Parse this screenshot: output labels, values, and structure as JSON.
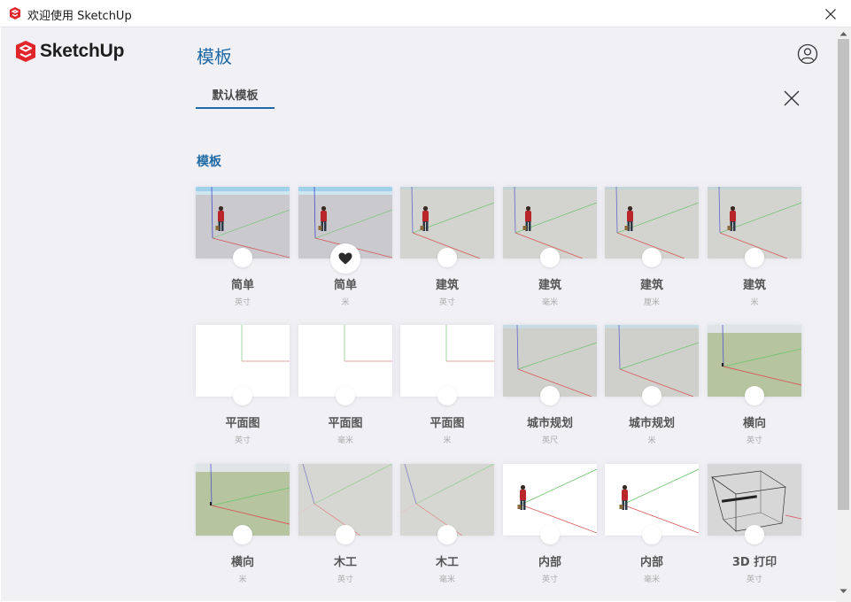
{
  "window": {
    "title": "欢迎使用 SketchUp"
  },
  "brand": {
    "logo_text": "SketchUp",
    "accent_color": "#1f6aa6",
    "logo_color": "#e0262b"
  },
  "header": {
    "page_title": "模板"
  },
  "tabs": [
    {
      "label": "默认模板",
      "active": true
    }
  ],
  "section": {
    "title": "模板"
  },
  "templates": [
    {
      "name": "简单",
      "unit": "英寸",
      "style": "simple",
      "favorite": false
    },
    {
      "name": "简单",
      "unit": "米",
      "style": "simple",
      "favorite": true
    },
    {
      "name": "建筑",
      "unit": "英寸",
      "style": "arch",
      "favorite": false
    },
    {
      "name": "建筑",
      "unit": "毫米",
      "style": "arch",
      "favorite": false
    },
    {
      "name": "建筑",
      "unit": "厘米",
      "style": "arch",
      "favorite": false
    },
    {
      "name": "建筑",
      "unit": "米",
      "style": "arch",
      "favorite": false
    },
    {
      "name": "平面图",
      "unit": "英寸",
      "style": "plan",
      "favorite": false
    },
    {
      "name": "平面图",
      "unit": "毫米",
      "style": "plan",
      "favorite": false
    },
    {
      "name": "平面图",
      "unit": "米",
      "style": "plan",
      "favorite": false
    },
    {
      "name": "城市规划",
      "unit": "英尺",
      "style": "urban",
      "favorite": false
    },
    {
      "name": "城市规划",
      "unit": "米",
      "style": "urban",
      "favorite": false
    },
    {
      "name": "横向",
      "unit": "英寸",
      "style": "landscape",
      "favorite": false
    },
    {
      "name": "横向",
      "unit": "米",
      "style": "landscape",
      "favorite": false
    },
    {
      "name": "木工",
      "unit": "英寸",
      "style": "wood",
      "favorite": false
    },
    {
      "name": "木工",
      "unit": "毫米",
      "style": "wood",
      "favorite": false
    },
    {
      "name": "内部",
      "unit": "英寸",
      "style": "interior",
      "favorite": false
    },
    {
      "name": "内部",
      "unit": "毫米",
      "style": "interior",
      "favorite": false
    },
    {
      "name": "3D 打印",
      "unit": "英寸",
      "style": "print3d",
      "favorite": false
    }
  ]
}
